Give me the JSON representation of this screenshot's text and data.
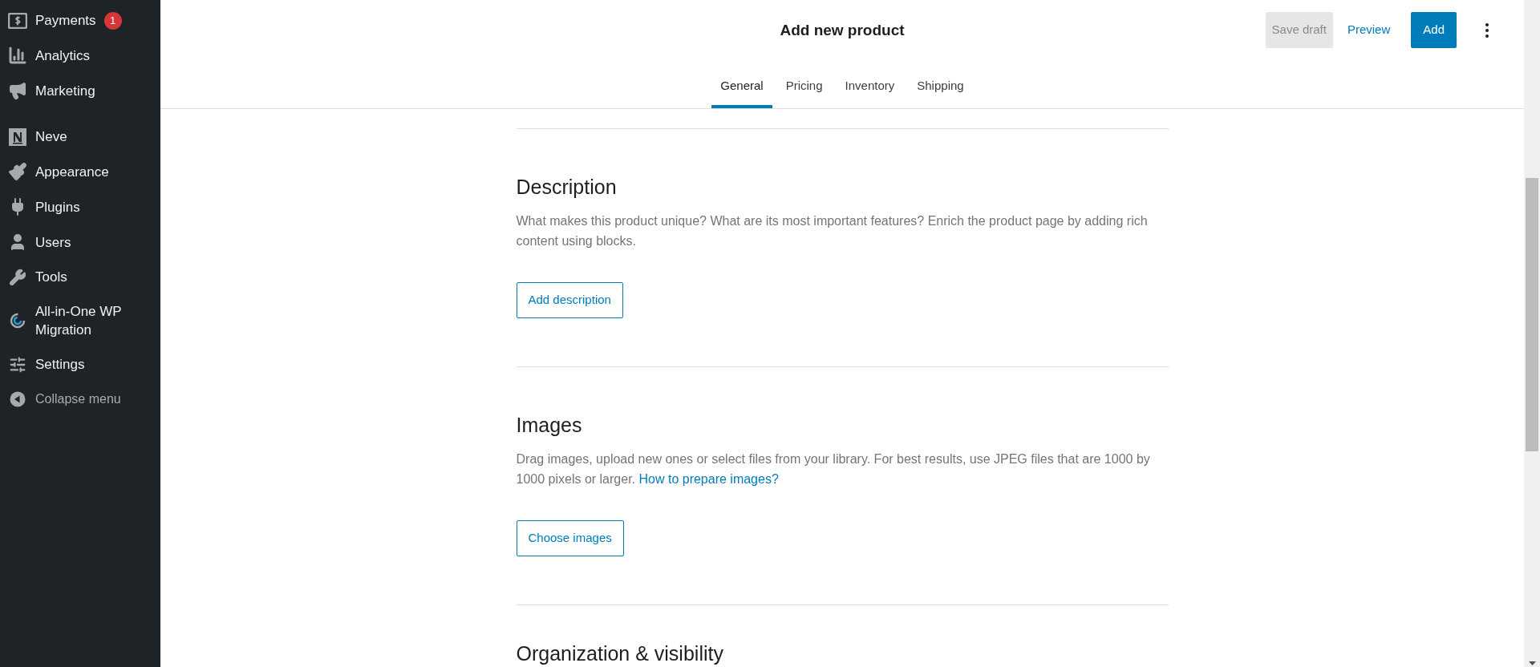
{
  "sidebar": {
    "items": [
      {
        "label": "Payments",
        "badge": "1"
      },
      {
        "label": "Analytics"
      },
      {
        "label": "Marketing"
      },
      {
        "label": "Neve",
        "group_start": true
      },
      {
        "label": "Appearance"
      },
      {
        "label": "Plugins"
      },
      {
        "label": "Users"
      },
      {
        "label": "Tools"
      },
      {
        "label": "All-in-One WP Migration"
      },
      {
        "label": "Settings"
      }
    ],
    "collapse_menu": "Collapse menu"
  },
  "header": {
    "title": "Add new product",
    "save_draft": {
      "label": "Save draft",
      "disabled": true
    },
    "preview": "Preview",
    "add": "Add"
  },
  "tabs": [
    {
      "label": "General",
      "selected": true
    },
    {
      "label": "Pricing",
      "selected": false
    },
    {
      "label": "Inventory",
      "selected": false
    },
    {
      "label": "Shipping",
      "selected": false
    }
  ],
  "sections": [
    {
      "heading": "Description",
      "description": "What makes this product unique? What are its most important features? Enrich the product page by adding rich content using blocks.",
      "button": "Add description"
    },
    {
      "heading": "Images",
      "description": "Drag images, upload new ones or select files from your library. For best results, use JPEG files that are 1000 by 1000 pixels or larger.",
      "link": "How to prepare images?",
      "button": "Choose images"
    },
    {
      "heading": "Organization & visibility"
    }
  ]
}
